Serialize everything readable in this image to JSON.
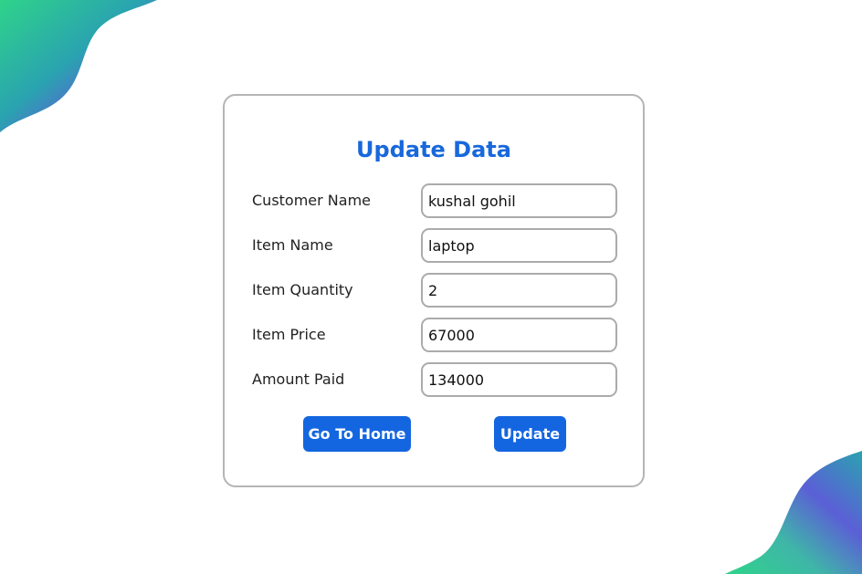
{
  "form": {
    "title": "Update Data",
    "fields": [
      {
        "label": "Customer Name",
        "value": "kushal gohil"
      },
      {
        "label": "Item Name",
        "value": "laptop"
      },
      {
        "label": "Item Quantity",
        "value": "2"
      },
      {
        "label": "Item Price",
        "value": "67000"
      },
      {
        "label": "Amount Paid",
        "value": "134000"
      }
    ],
    "home_button": "Go To Home",
    "update_button": "Update"
  },
  "colors": {
    "accent": "#1868dc",
    "button": "#1466e0",
    "card_border": "#b5b5b5",
    "field_border": "#ababab",
    "blob_gradient": [
      "#3a8fe0",
      "#5b5fd6",
      "#2fd38a"
    ]
  }
}
